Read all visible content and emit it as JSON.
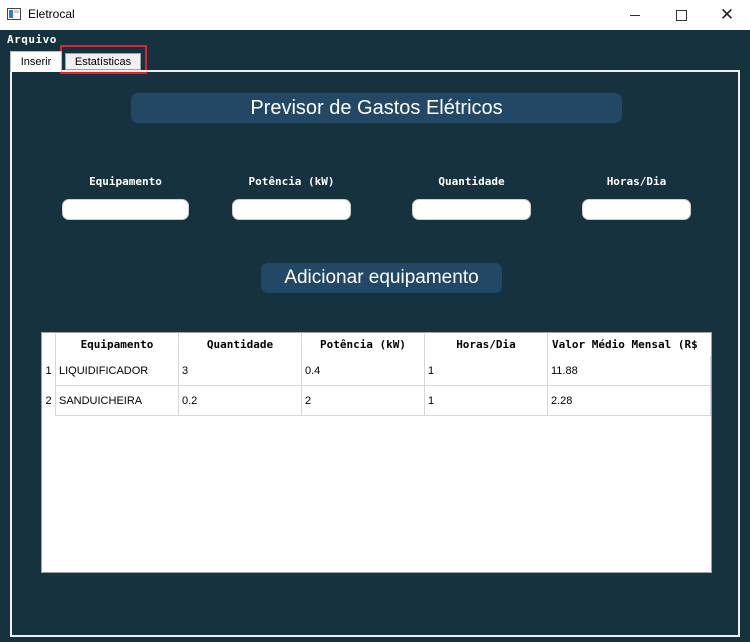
{
  "window": {
    "title": "Eletrocal"
  },
  "menubar": {
    "arquivo": "Arquivo"
  },
  "tabs": [
    {
      "label": "Inserir",
      "active": true
    },
    {
      "label": "Estatísticas",
      "active": false
    }
  ],
  "main": {
    "title": "Previsor de Gastos Elétricos",
    "fields": [
      {
        "label": "Equipamento",
        "value": ""
      },
      {
        "label": "Potência (kW)",
        "value": ""
      },
      {
        "label": "Quantidade",
        "value": ""
      },
      {
        "label": "Horas/Dia",
        "value": ""
      }
    ],
    "add_button": "Adicionar equipamento"
  },
  "table": {
    "columns": [
      "Equipamento",
      "Quantidade",
      "Potência (kW)",
      "Horas/Dia",
      "Valor Médio Mensal (R$"
    ],
    "rows": [
      {
        "index": "1",
        "cells": [
          "LIQUIDIFICADOR",
          "3",
          "0.4",
          "1",
          "11.88"
        ]
      },
      {
        "index": "2",
        "cells": [
          "SANDUICHEIRA",
          "0.2",
          "2",
          "1",
          "2.28"
        ]
      }
    ]
  },
  "colors": {
    "background": "#16323f",
    "header_box": "#234866",
    "highlight": "#e0242e"
  }
}
